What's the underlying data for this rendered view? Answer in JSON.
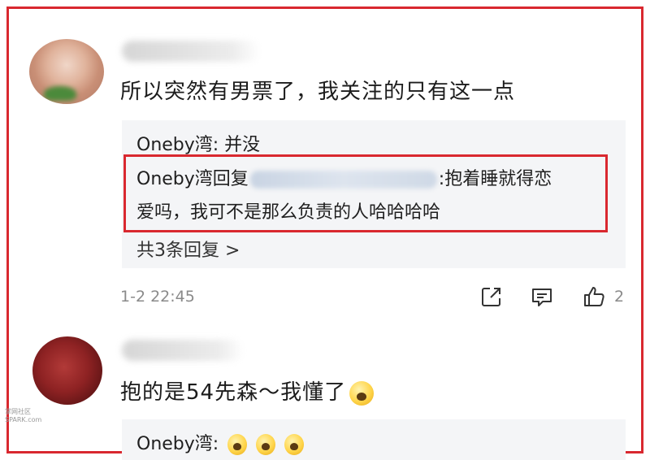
{
  "comment1": {
    "text": "所以突然有男票了，我关注的只有这一点",
    "replies": {
      "line1": "Oneby湾: 并没",
      "highlighted_prefix": "Oneby湾回复",
      "highlighted_suffix": ":抱着睡就得恋",
      "highlighted_line2": "爱吗，我可不是那么负责的人哈哈哈哈",
      "more": "共3条回复 >"
    },
    "timestamp": "1-2 22:45",
    "like_count": "2"
  },
  "comment2": {
    "text": "抱的是54先森～我懂了",
    "reply_prefix": "Oneby湾:"
  },
  "icons": {
    "share": "share-icon",
    "message": "message-icon",
    "like": "thumbs-up-icon"
  },
  "colors": {
    "highlight_border": "#d9282f",
    "reply_bg": "#f4f5f7",
    "meta_text": "#8a8a8a"
  },
  "watermark": {
    "line1": "掌网社区",
    "line2": "SPARK.com"
  }
}
